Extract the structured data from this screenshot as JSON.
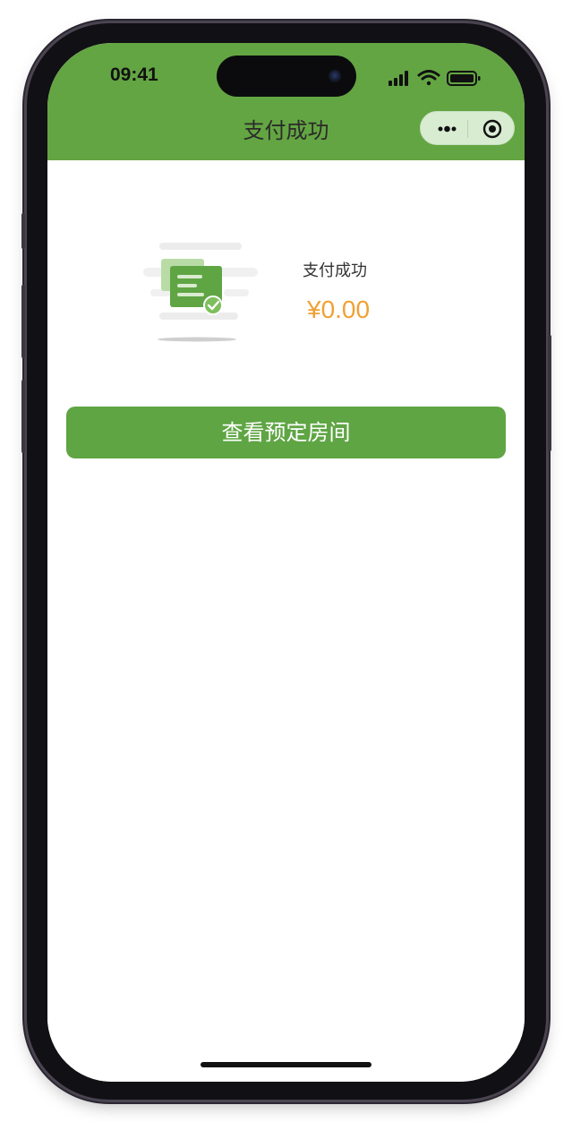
{
  "status_bar": {
    "time": "09:41"
  },
  "nav": {
    "title": "支付成功",
    "capsule": {
      "more_icon": "more-dots-icon",
      "close_icon": "target-circle-icon"
    }
  },
  "payment": {
    "status_text": "支付成功",
    "amount": "¥0.00",
    "illustration_icon": "receipt-check-icon"
  },
  "actions": {
    "view_room_label": "查看预定房间"
  },
  "colors": {
    "brand_green": "#63a542",
    "button_green": "#5fa544",
    "amount_orange": "#f0a133"
  }
}
